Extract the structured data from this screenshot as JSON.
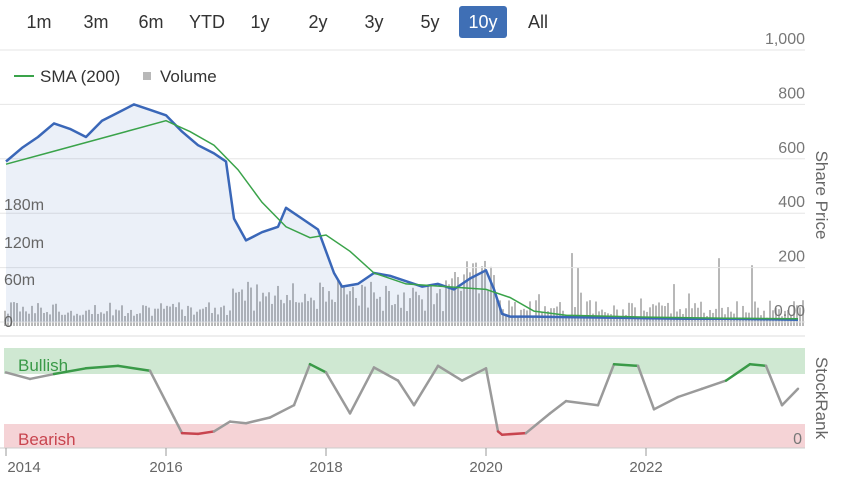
{
  "range_buttons": [
    {
      "label": "1m"
    },
    {
      "label": "3m"
    },
    {
      "label": "6m"
    },
    {
      "label": "YTD"
    },
    {
      "label": "1y"
    },
    {
      "label": "2y"
    },
    {
      "label": "3y"
    },
    {
      "label": "5y"
    },
    {
      "label": "10y",
      "active": true
    },
    {
      "label": "All"
    }
  ],
  "legend": {
    "sma_label": "SMA (200)",
    "volume_label": "Volume"
  },
  "colors": {
    "price": "#3a67b8",
    "sma": "#3aa34a",
    "volume": "#b8b8b8",
    "bullish": "#3a9a48",
    "bearish": "#c8454f",
    "rank": "#9a9a9a"
  },
  "chart_data": [
    {
      "type": "line",
      "title": "",
      "ylabel": "Share Price",
      "y_ticks": [
        "1,000",
        "800",
        "600",
        "400",
        "200",
        "0.00"
      ],
      "ylim": [
        0,
        1000
      ],
      "x_ticks": [
        "2014",
        "2016",
        "2018",
        "2020",
        "2022"
      ],
      "series": [
        {
          "name": "Price",
          "x": [
            2014.0,
            2014.2,
            2014.4,
            2014.6,
            2014.8,
            2015.0,
            2015.2,
            2015.4,
            2015.6,
            2015.8,
            2016.0,
            2016.2,
            2016.4,
            2016.6,
            2016.7,
            2016.75,
            2016.85,
            2017.0,
            2017.2,
            2017.4,
            2017.5,
            2017.7,
            2017.9,
            2018.0,
            2018.1,
            2018.2,
            2018.4,
            2018.6,
            2018.8,
            2019.0,
            2019.2,
            2019.4,
            2019.6,
            2019.8,
            2020.0,
            2020.1,
            2020.2,
            2020.3,
            2020.6,
            2021.0,
            2021.5,
            2022.0,
            2022.5,
            2023.0,
            2023.5,
            2023.9
          ],
          "values": [
            590,
            640,
            680,
            730,
            710,
            680,
            740,
            770,
            800,
            780,
            760,
            700,
            650,
            620,
            600,
            590,
            380,
            300,
            330,
            350,
            420,
            380,
            340,
            260,
            180,
            130,
            140,
            180,
            170,
            150,
            130,
            140,
            120,
            160,
            190,
            120,
            30,
            20,
            20,
            18,
            16,
            14,
            12,
            12,
            10,
            8
          ]
        },
        {
          "name": "SMA (200)",
          "x": [
            2014.0,
            2014.5,
            2015.0,
            2015.5,
            2016.0,
            2016.3,
            2016.6,
            2016.9,
            2017.2,
            2017.5,
            2017.8,
            2018.0,
            2018.3,
            2018.6,
            2019.0,
            2019.5,
            2020.0,
            2020.3,
            2020.6,
            2021.0,
            2022.0,
            2023.0,
            2023.9
          ],
          "values": [
            580,
            620,
            660,
            700,
            740,
            700,
            650,
            560,
            440,
            350,
            310,
            320,
            260,
            180,
            140,
            130,
            120,
            90,
            40,
            25,
            18,
            14,
            12
          ]
        },
        {
          "name": "Volume",
          "scale_ticks": [
            "180m",
            "120m",
            "60m",
            "0"
          ]
        }
      ]
    },
    {
      "type": "line",
      "title": "",
      "ylabel": "StockRank",
      "zone_labels": [
        "Bullish",
        "Bearish"
      ],
      "y_tick": "0",
      "ylim": [
        0,
        100
      ],
      "series": [
        {
          "name": "StockRank",
          "x": [
            2014.0,
            2014.3,
            2014.6,
            2015.0,
            2015.4,
            2015.8,
            2016.1,
            2016.2,
            2016.4,
            2016.6,
            2016.8,
            2017.0,
            2017.3,
            2017.6,
            2017.8,
            2018.0,
            2018.3,
            2018.6,
            2018.9,
            2019.1,
            2019.4,
            2019.7,
            2020.0,
            2020.15,
            2020.2,
            2020.5,
            2020.8,
            2021.0,
            2021.4,
            2021.6,
            2021.9,
            2022.1,
            2022.4,
            2022.7,
            2023.0,
            2023.3,
            2023.5,
            2023.7,
            2023.9
          ],
          "values": [
            80,
            72,
            78,
            85,
            88,
            82,
            25,
            6,
            5,
            8,
            20,
            18,
            25,
            40,
            90,
            80,
            30,
            86,
            70,
            40,
            88,
            70,
            85,
            8,
            4,
            6,
            30,
            45,
            40,
            90,
            88,
            35,
            50,
            60,
            70,
            90,
            88,
            40,
            60
          ]
        }
      ]
    }
  ]
}
